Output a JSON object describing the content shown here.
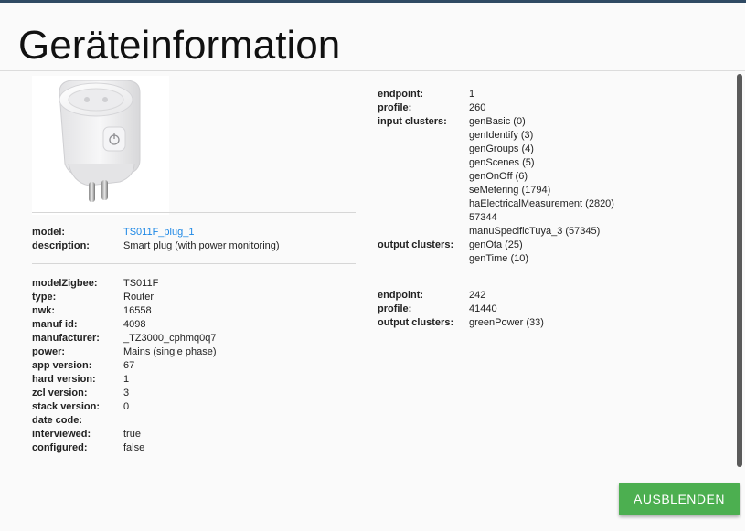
{
  "dialog": {
    "title": "Geräteinformation",
    "close_button_label": "AUSBLENDEN"
  },
  "device": {
    "model_label": "model:",
    "model_value": "TS011F_plug_1",
    "description_label": "description:",
    "description_value": "Smart plug (with power monitoring)",
    "details": [
      {
        "label": "modelZigbee:",
        "value": "TS011F"
      },
      {
        "label": "type:",
        "value": "Router"
      },
      {
        "label": "nwk:",
        "value": "16558"
      },
      {
        "label": "manuf id:",
        "value": "4098"
      },
      {
        "label": "manufacturer:",
        "value": "_TZ3000_cphmq0q7"
      },
      {
        "label": "power:",
        "value": "Mains (single phase)"
      },
      {
        "label": "app version:",
        "value": "67"
      },
      {
        "label": "hard version:",
        "value": "1"
      },
      {
        "label": "zcl version:",
        "value": "3"
      },
      {
        "label": "stack version:",
        "value": "0"
      },
      {
        "label": "date code:",
        "value": ""
      },
      {
        "label": "interviewed:",
        "value": "true"
      },
      {
        "label": "configured:",
        "value": "false"
      }
    ]
  },
  "endpoints": [
    {
      "endpoint_label": "endpoint:",
      "endpoint": "1",
      "profile_label": "profile:",
      "profile": "260",
      "input_label": "input clusters:",
      "input_clusters": [
        "genBasic (0)",
        "genIdentify (3)",
        "genGroups (4)",
        "genScenes (5)",
        "genOnOff (6)",
        "seMetering (1794)",
        "haElectricalMeasurement (2820)",
        "57344",
        "manuSpecificTuya_3 (57345)"
      ],
      "output_label": "output clusters:",
      "output_clusters": [
        "genOta (25)",
        "genTime (10)"
      ]
    },
    {
      "endpoint_label": "endpoint:",
      "endpoint": "242",
      "profile_label": "profile:",
      "profile": "41440",
      "output_label": "output clusters:",
      "output_clusters": [
        "greenPower (33)"
      ]
    }
  ]
}
